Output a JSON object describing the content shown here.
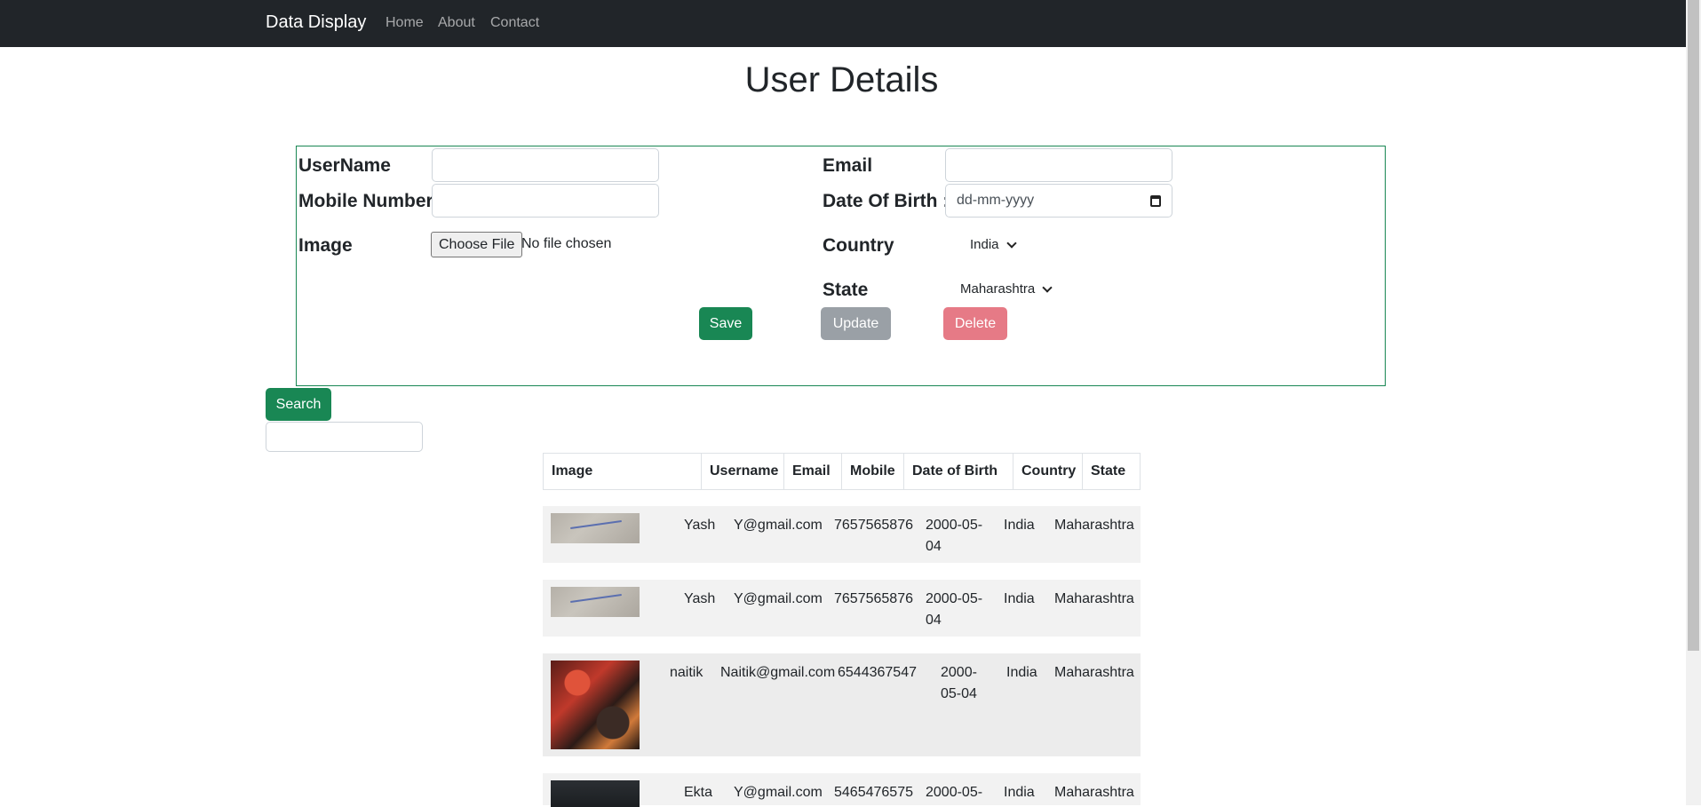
{
  "nav": {
    "brand": "Data Display",
    "links": [
      "Home",
      "About",
      "Contact"
    ]
  },
  "page": {
    "title": "User Details"
  },
  "form": {
    "username_label": "UserName",
    "mobile_label": "Mobile Number",
    "image_label": "Image",
    "email_label": "Email",
    "dob_label": "Date Of Birth :",
    "dob_placeholder": "dd-mm-yyyy",
    "country_label": "Country",
    "country_value": "India",
    "state_label": "State",
    "state_value": "Maharashtra",
    "file_button": "Choose File",
    "file_status": "No file chosen",
    "save_label": "Save",
    "update_label": "Update",
    "delete_label": "Delete"
  },
  "search": {
    "button_label": "Search"
  },
  "table": {
    "headers": [
      "Image",
      "Username",
      "Email",
      "Mobile",
      "Date of Birth",
      "Country",
      "State"
    ],
    "rows": [
      {
        "username": "Yash",
        "email": "Y@gmail.com",
        "mobile": "7657565876",
        "dob_line1": "2000-05-",
        "dob_line2": "04",
        "country": "India",
        "state": "Maharashtra"
      },
      {
        "username": "Yash",
        "email": "Y@gmail.com",
        "mobile": "7657565876",
        "dob_line1": "2000-05-",
        "dob_line2": "04",
        "country": "India",
        "state": "Maharashtra"
      },
      {
        "username": "naitik",
        "email": "Naitik@gmail.com",
        "mobile": "6544367547",
        "dob_line1": "2000-",
        "dob_line2": "05-04",
        "country": "India",
        "state": "Maharashtra"
      },
      {
        "username": "Ekta",
        "email": "Y@gmail.com",
        "mobile": "5465476575",
        "dob_line1": "2000-05-",
        "dob_line2": "",
        "country": "India",
        "state": "Maharashtra"
      }
    ]
  }
}
